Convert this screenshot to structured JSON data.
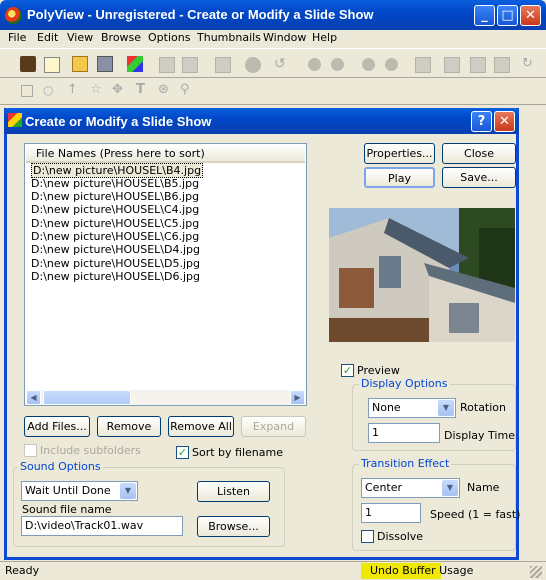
{
  "window": {
    "title": "PolyView - Unregistered - Create or Modify a Slide Show"
  },
  "menu": [
    "File",
    "Edit",
    "View",
    "Browse",
    "Options",
    "Thumbnails",
    "Window",
    "Help"
  ],
  "dialog": {
    "title": "Create or Modify a Slide Show",
    "help_label": "?",
    "close_label": "✕",
    "file_list": {
      "header": "File Names (Press here to sort)",
      "items": [
        "D:\\new picture\\HOUSEL\\B4.jpg",
        "D:\\new picture\\HOUSEL\\B5.jpg",
        "D:\\new picture\\HOUSEL\\B6.jpg",
        "D:\\new picture\\HOUSEL\\C4.jpg",
        "D:\\new picture\\HOUSEL\\C5.jpg",
        "D:\\new picture\\HOUSEL\\C6.jpg",
        "D:\\new picture\\HOUSEL\\D4.jpg",
        "D:\\new picture\\HOUSEL\\D5.jpg",
        "D:\\new picture\\HOUSEL\\D6.jpg"
      ]
    },
    "buttons": {
      "properties": "Properties...",
      "close": "Close",
      "play": "Play",
      "save": "Save...",
      "add_files": "Add Files...",
      "remove": "Remove",
      "remove_all": "Remove All",
      "expand": "Expand",
      "listen": "Listen",
      "browse": "Browse..."
    },
    "include_subfolders": "Include subfolders",
    "sort_by_filename": "Sort by filename",
    "preview_label": "Preview",
    "sound": {
      "group": "Sound Options",
      "mode": "Wait Until Done",
      "file_label": "Sound file name",
      "file_value": "D:\\video\\Track01.wav"
    },
    "display": {
      "group": "Display Options",
      "rotation_value": "None",
      "rotation_label": "Rotation",
      "time_value": "1",
      "time_label": "Display Time"
    },
    "transition": {
      "group": "Transition Effect",
      "name_value": "Center",
      "name_label": "Name",
      "speed_value": "1",
      "speed_label": "Speed (1 = fast)",
      "dissolve_label": "Dissolve"
    }
  },
  "status": {
    "left": "Ready",
    "middle": "Undo Buffer Usage"
  },
  "colors": {
    "title_blue": "#0a4fd4",
    "group_label": "#0046d5",
    "status_highlight": "#f0e800"
  }
}
